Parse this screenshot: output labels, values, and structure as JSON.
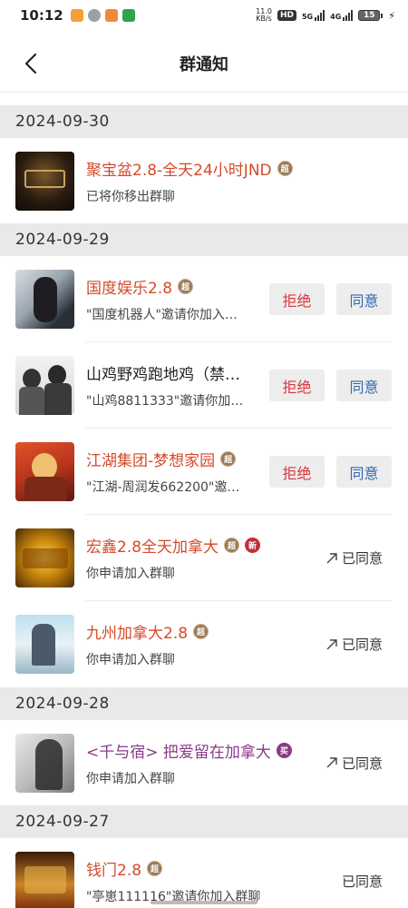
{
  "status_bar": {
    "time": "10:12",
    "speed_value": "11.0",
    "speed_unit": "KB/s",
    "hd_label": "HD",
    "net1": "5G",
    "net2": "4G",
    "battery": "15"
  },
  "header": {
    "title": "群通知",
    "back_icon": "chevron-left-icon"
  },
  "actions": {
    "reject_label": "拒绝",
    "accept_label": "同意",
    "accepted_label": "已同意"
  },
  "sections": [
    {
      "date": "2024-09-30",
      "items": [
        {
          "name": "聚宝盆2.8-全天24小时JND",
          "tag": "超",
          "sub": "已将你移出群聊"
        }
      ]
    },
    {
      "date": "2024-09-29",
      "items": [
        {
          "name": "国度娱乐2.8",
          "tag": "超",
          "sub": "\"国度机器人\"邀请你加入…"
        },
        {
          "name": "山鸡野鸡跑地鸡（禁…",
          "sub": "\"山鸡8811333\"邀请你加…"
        },
        {
          "name": "江湖集团-梦想家园",
          "tag": "超",
          "sub": "\"江湖-周润发662200\"邀…"
        },
        {
          "name": "宏鑫2.8全天加拿大",
          "tag": "超",
          "tag2": "新",
          "sub": "你申请加入群聊"
        },
        {
          "name": "九州加拿大2.8",
          "tag": "超",
          "sub": "你申请加入群聊"
        }
      ]
    },
    {
      "date": "2024-09-28",
      "items": [
        {
          "name": "<千与宿> 把爱留在加拿大",
          "tag": "买",
          "sub": "你申请加入群聊"
        }
      ]
    },
    {
      "date": "2024-09-27",
      "items": [
        {
          "name": "钱门2.8",
          "tag": "超",
          "sub": "\"亭崽111116\"邀请你加入群聊"
        }
      ]
    }
  ],
  "colors": {
    "name_red": "#d54a2a",
    "reject_red": "#d9363e",
    "accept_blue": "#2f6ab0",
    "section_bg": "#e9e9e9"
  }
}
